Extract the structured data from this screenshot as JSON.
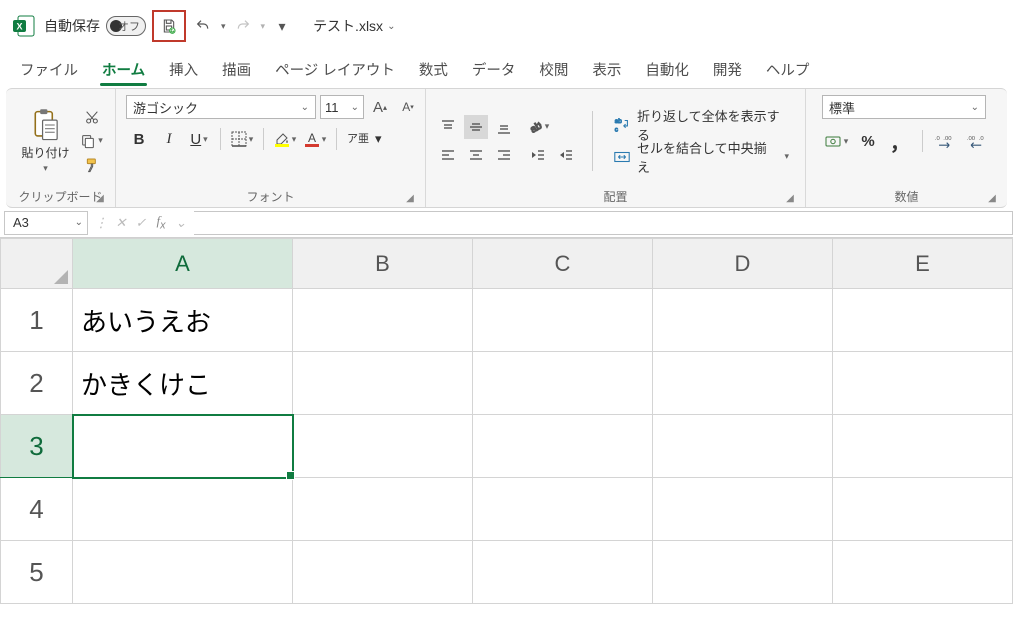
{
  "titlebar": {
    "autosave_label": "自動保存",
    "autosave_state": "オフ",
    "filename": "テスト.xlsx"
  },
  "tabs": {
    "file": "ファイル",
    "home": "ホーム",
    "insert": "挿入",
    "draw": "描画",
    "pagelayout": "ページ レイアウト",
    "formulas": "数式",
    "data": "データ",
    "review": "校閲",
    "view": "表示",
    "automate": "自動化",
    "developer": "開発",
    "help": "ヘルプ",
    "active": "home"
  },
  "ribbon": {
    "clipboard": {
      "paste": "貼り付け",
      "label": "クリップボード"
    },
    "font": {
      "name": "游ゴシック",
      "size": "11",
      "bold": "B",
      "italic": "I",
      "underline": "U",
      "ruby": "ア亜",
      "label": "フォント"
    },
    "alignment": {
      "wrap": "折り返して全体を表示する",
      "merge": "セルを結合して中央揃え",
      "label": "配置"
    },
    "number": {
      "format": "標準",
      "percent": "%",
      "comma": "，",
      "inc": ".00→.0",
      "dec": ".0→.00",
      "label": "数値"
    }
  },
  "formula_bar": {
    "name_box": "A3",
    "formula": ""
  },
  "grid": {
    "columns": [
      "A",
      "B",
      "C",
      "D",
      "E"
    ],
    "rows": [
      "1",
      "2",
      "3",
      "4",
      "5"
    ],
    "cells": {
      "A1": "あいうえお",
      "A2": "かきくけこ"
    },
    "selected": "A3"
  }
}
